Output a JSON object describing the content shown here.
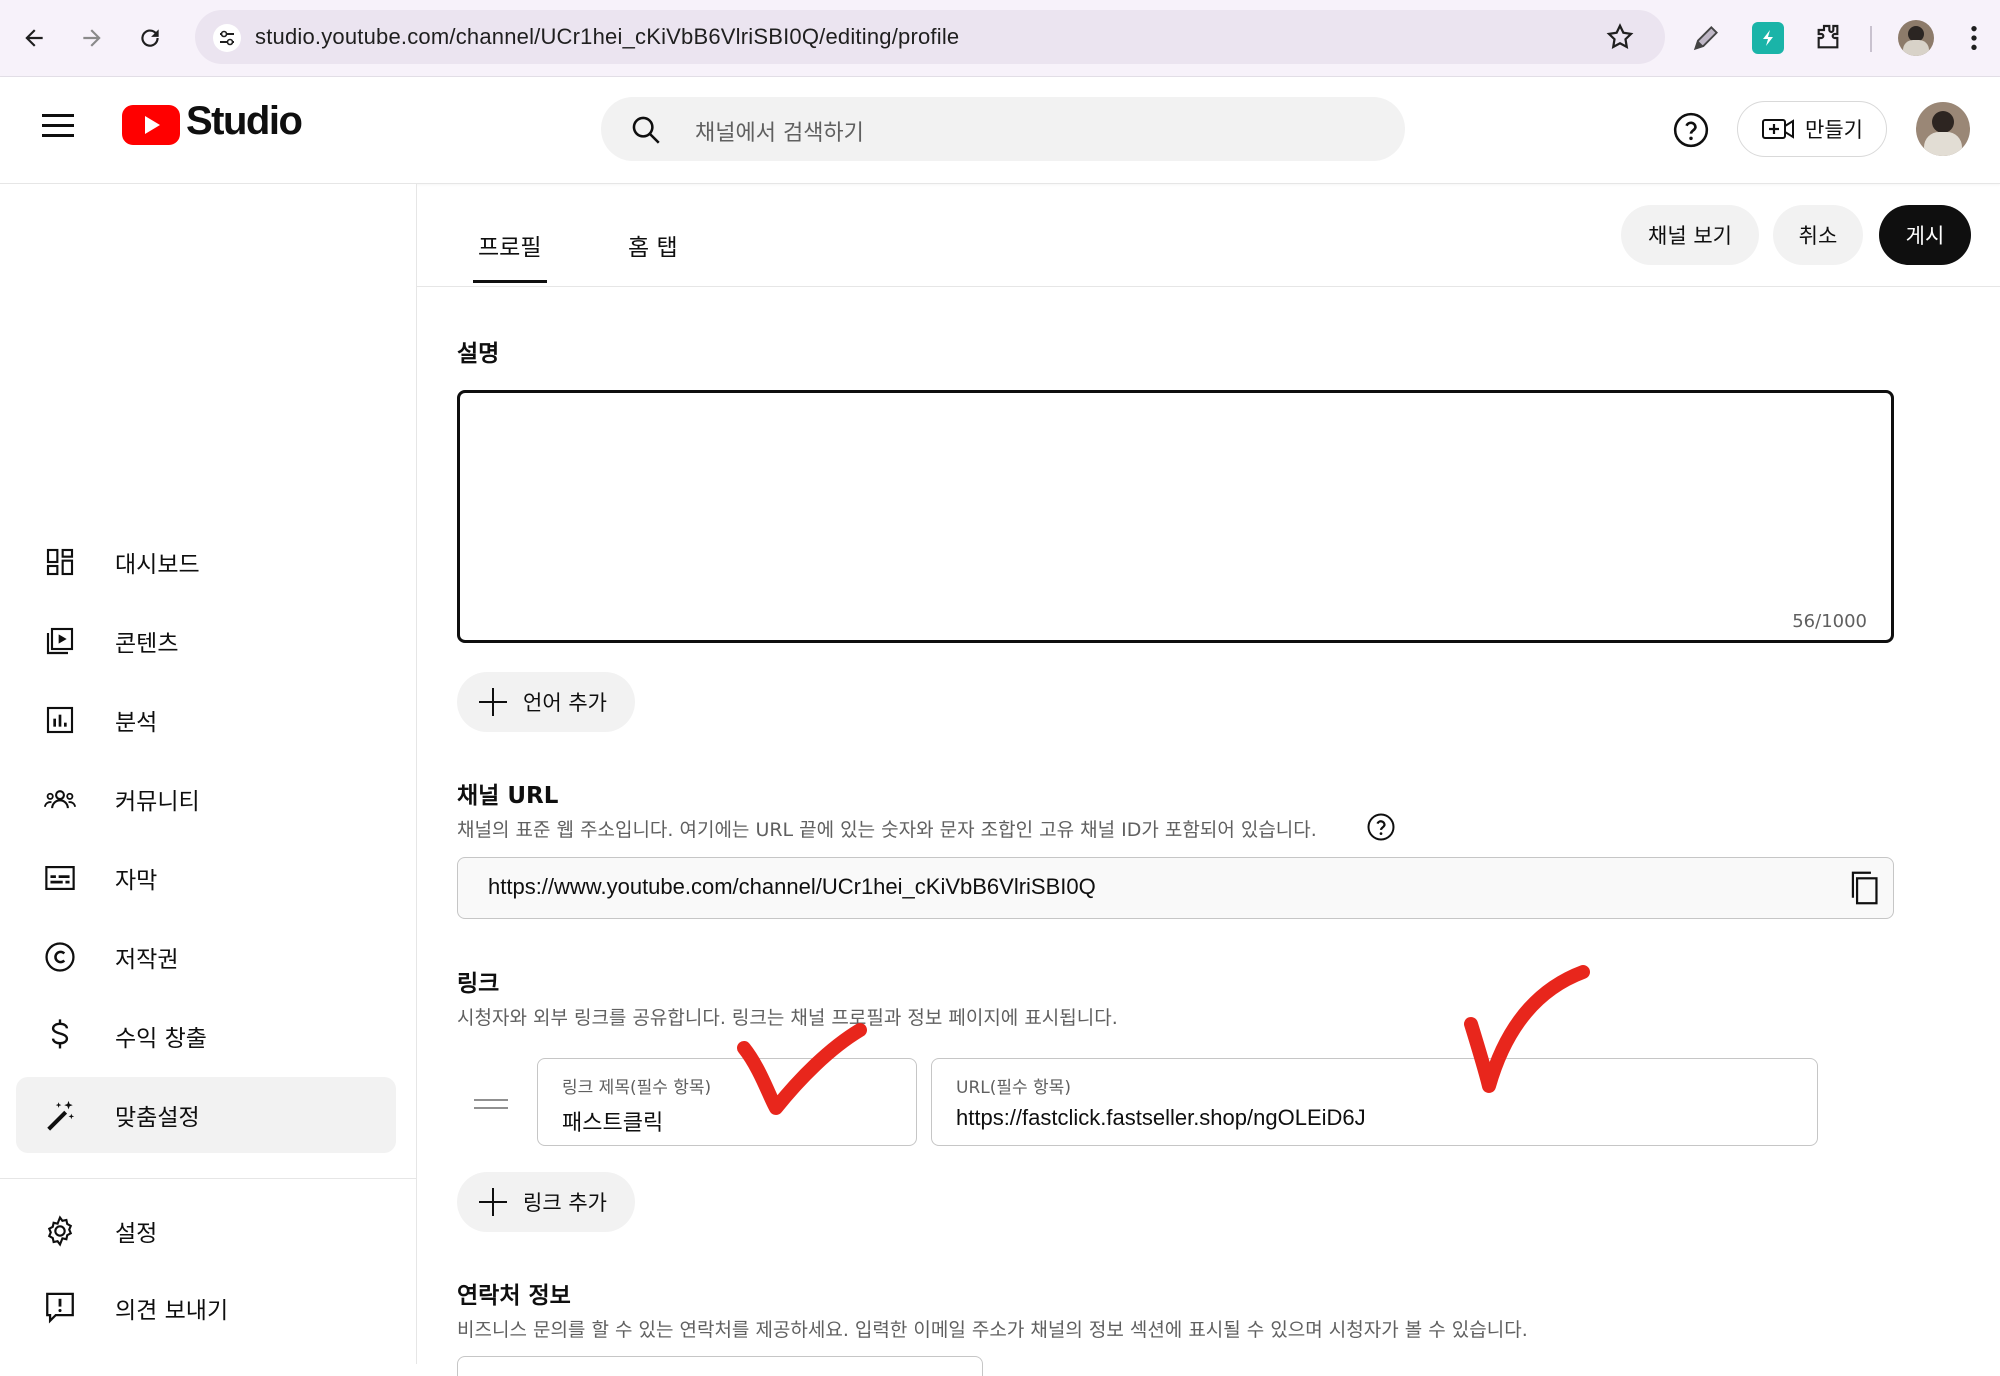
{
  "browser": {
    "url": "studio.youtube.com/channel/UCr1hei_cKiVbB6VlriSBI0Q/editing/profile"
  },
  "header": {
    "logo_text": "Studio",
    "search_placeholder": "채널에서 검색하기",
    "create_label": "만들기"
  },
  "sidebar": {
    "items": [
      {
        "label": "대시보드",
        "icon": "dashboard-icon"
      },
      {
        "label": "콘텐츠",
        "icon": "content-icon"
      },
      {
        "label": "분석",
        "icon": "analytics-icon"
      },
      {
        "label": "커뮤니티",
        "icon": "community-icon"
      },
      {
        "label": "자막",
        "icon": "subtitles-icon"
      },
      {
        "label": "저작권",
        "icon": "copyright-icon"
      },
      {
        "label": "수익 창출",
        "icon": "dollar-icon"
      },
      {
        "label": "맞춤설정",
        "icon": "magic-wand-icon",
        "active": true
      }
    ],
    "bottom_items": [
      {
        "label": "설정",
        "icon": "gear-icon"
      },
      {
        "label": "의견 보내기",
        "icon": "feedback-icon"
      }
    ]
  },
  "tabs": [
    {
      "label": "프로필",
      "active": true
    },
    {
      "label": "홈 탭",
      "active": false
    }
  ],
  "actions": {
    "view_channel": "채널 보기",
    "cancel": "취소",
    "publish": "게시"
  },
  "description": {
    "title": "설명",
    "counter": "56/1000",
    "add_language": "언어 추가"
  },
  "channel_url": {
    "title": "채널 URL",
    "help": "채널의 표준 웹 주소입니다. 여기에는 URL 끝에 있는 숫자와 문자 조합인 고유 채널 ID가 포함되어 있습니다.",
    "value": "https://www.youtube.com/channel/UCr1hei_cKiVbB6VlriSBI0Q"
  },
  "links": {
    "title": "링크",
    "help": "시청자와 외부 링크를 공유합니다. 링크는 채널 프로필과 정보 페이지에 표시됩니다.",
    "items": [
      {
        "title_label": "링크 제목(필수 항목)",
        "title_value": "패스트클릭",
        "url_label": "URL(필수 항목)",
        "url_value": "https://fastclick.fastseller.shop/ngOLEiD6J"
      }
    ],
    "add_link": "링크 추가"
  },
  "contact": {
    "title": "연락처 정보",
    "help": "비즈니스 문의를 할 수 있는 연락처를 제공하세요. 입력한 이메일 주소가 채널의 정보 섹션에 표시될 수 있으며 시청자가 볼 수 있습니다."
  },
  "colors": {
    "youtube_red": "#ff0000",
    "annotation_red": "#e8261c",
    "publish_bg": "#0f0f0f"
  }
}
